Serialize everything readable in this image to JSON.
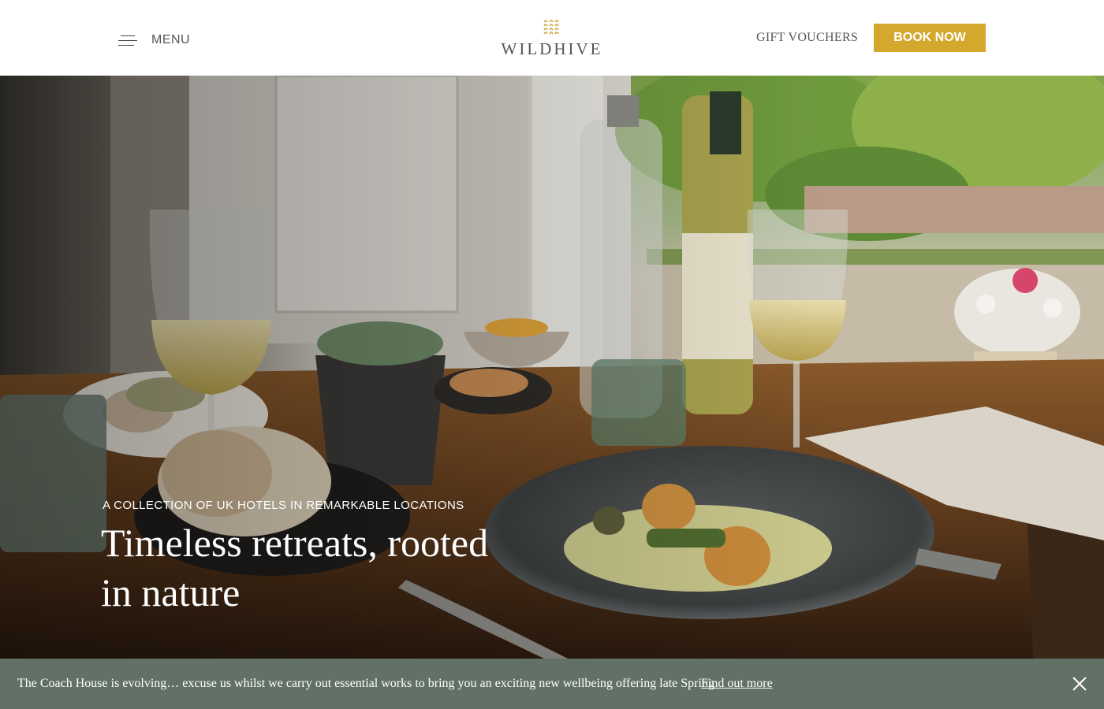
{
  "header": {
    "menu_label": "MENU",
    "logo_text": "WILDHIVE",
    "gift_label": "GIFT VOUCHERS",
    "book_label": "BOOK NOW"
  },
  "hero": {
    "kicker": "A COLLECTION OF UK HOTELS IN REMARKABLE LOCATIONS",
    "title_line1": "Timeless retreats, rooted",
    "title_line2": "in nature"
  },
  "notice": {
    "text": "The Coach House is evolving… excuse us whilst we carry out essential works to bring you an exciting new wellbeing offering late Spring",
    "link_label": "Find out more"
  },
  "icons": {
    "menu": "hamburger-icon",
    "logo": "wildhive-logo-icon",
    "close": "close-icon"
  },
  "colors": {
    "accent": "#d4a82d",
    "notice_bg": "#627166",
    "header_text": "#555555"
  }
}
